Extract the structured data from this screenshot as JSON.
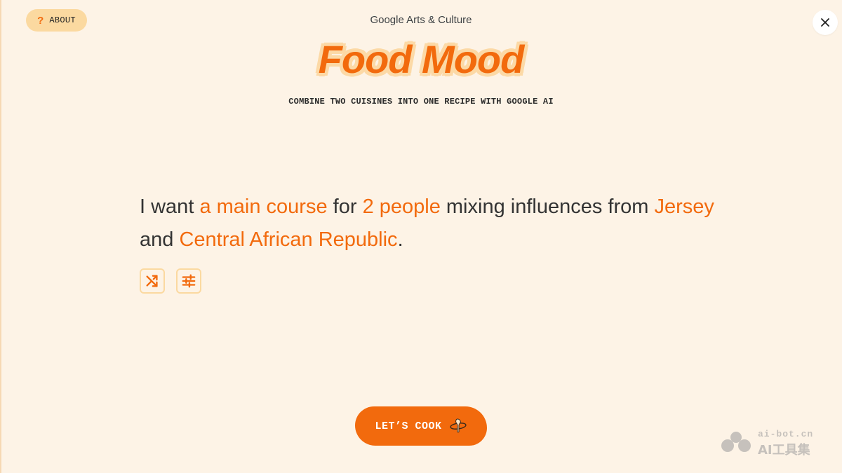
{
  "header": {
    "about_label": "ABOUT",
    "about_icon": "?",
    "brand": "Google Arts & Culture",
    "title": "Food Mood",
    "subtitle": "COMBINE TWO CUISINES INTO ONE RECIPE WITH GOOGLE AI"
  },
  "prompt": {
    "p1": "I want ",
    "course": "a main course",
    "p2": " for ",
    "servings": "2 people",
    "p3": " mixing influences from ",
    "cuisine1": "Jersey",
    "p4": " and ",
    "cuisine2": "Central African Republic",
    "p5": "."
  },
  "actions": {
    "shuffle_icon": "shuffle-icon",
    "settings_icon": "sliders-icon",
    "cook_label": "LET’S COOK"
  },
  "watermark": {
    "url": "ai-bot.cn",
    "text": "AI工具集"
  },
  "colors": {
    "background": "#fdf3e6",
    "accent": "#f26a0d",
    "accent_light": "#fbd9a0",
    "text": "#333333"
  }
}
